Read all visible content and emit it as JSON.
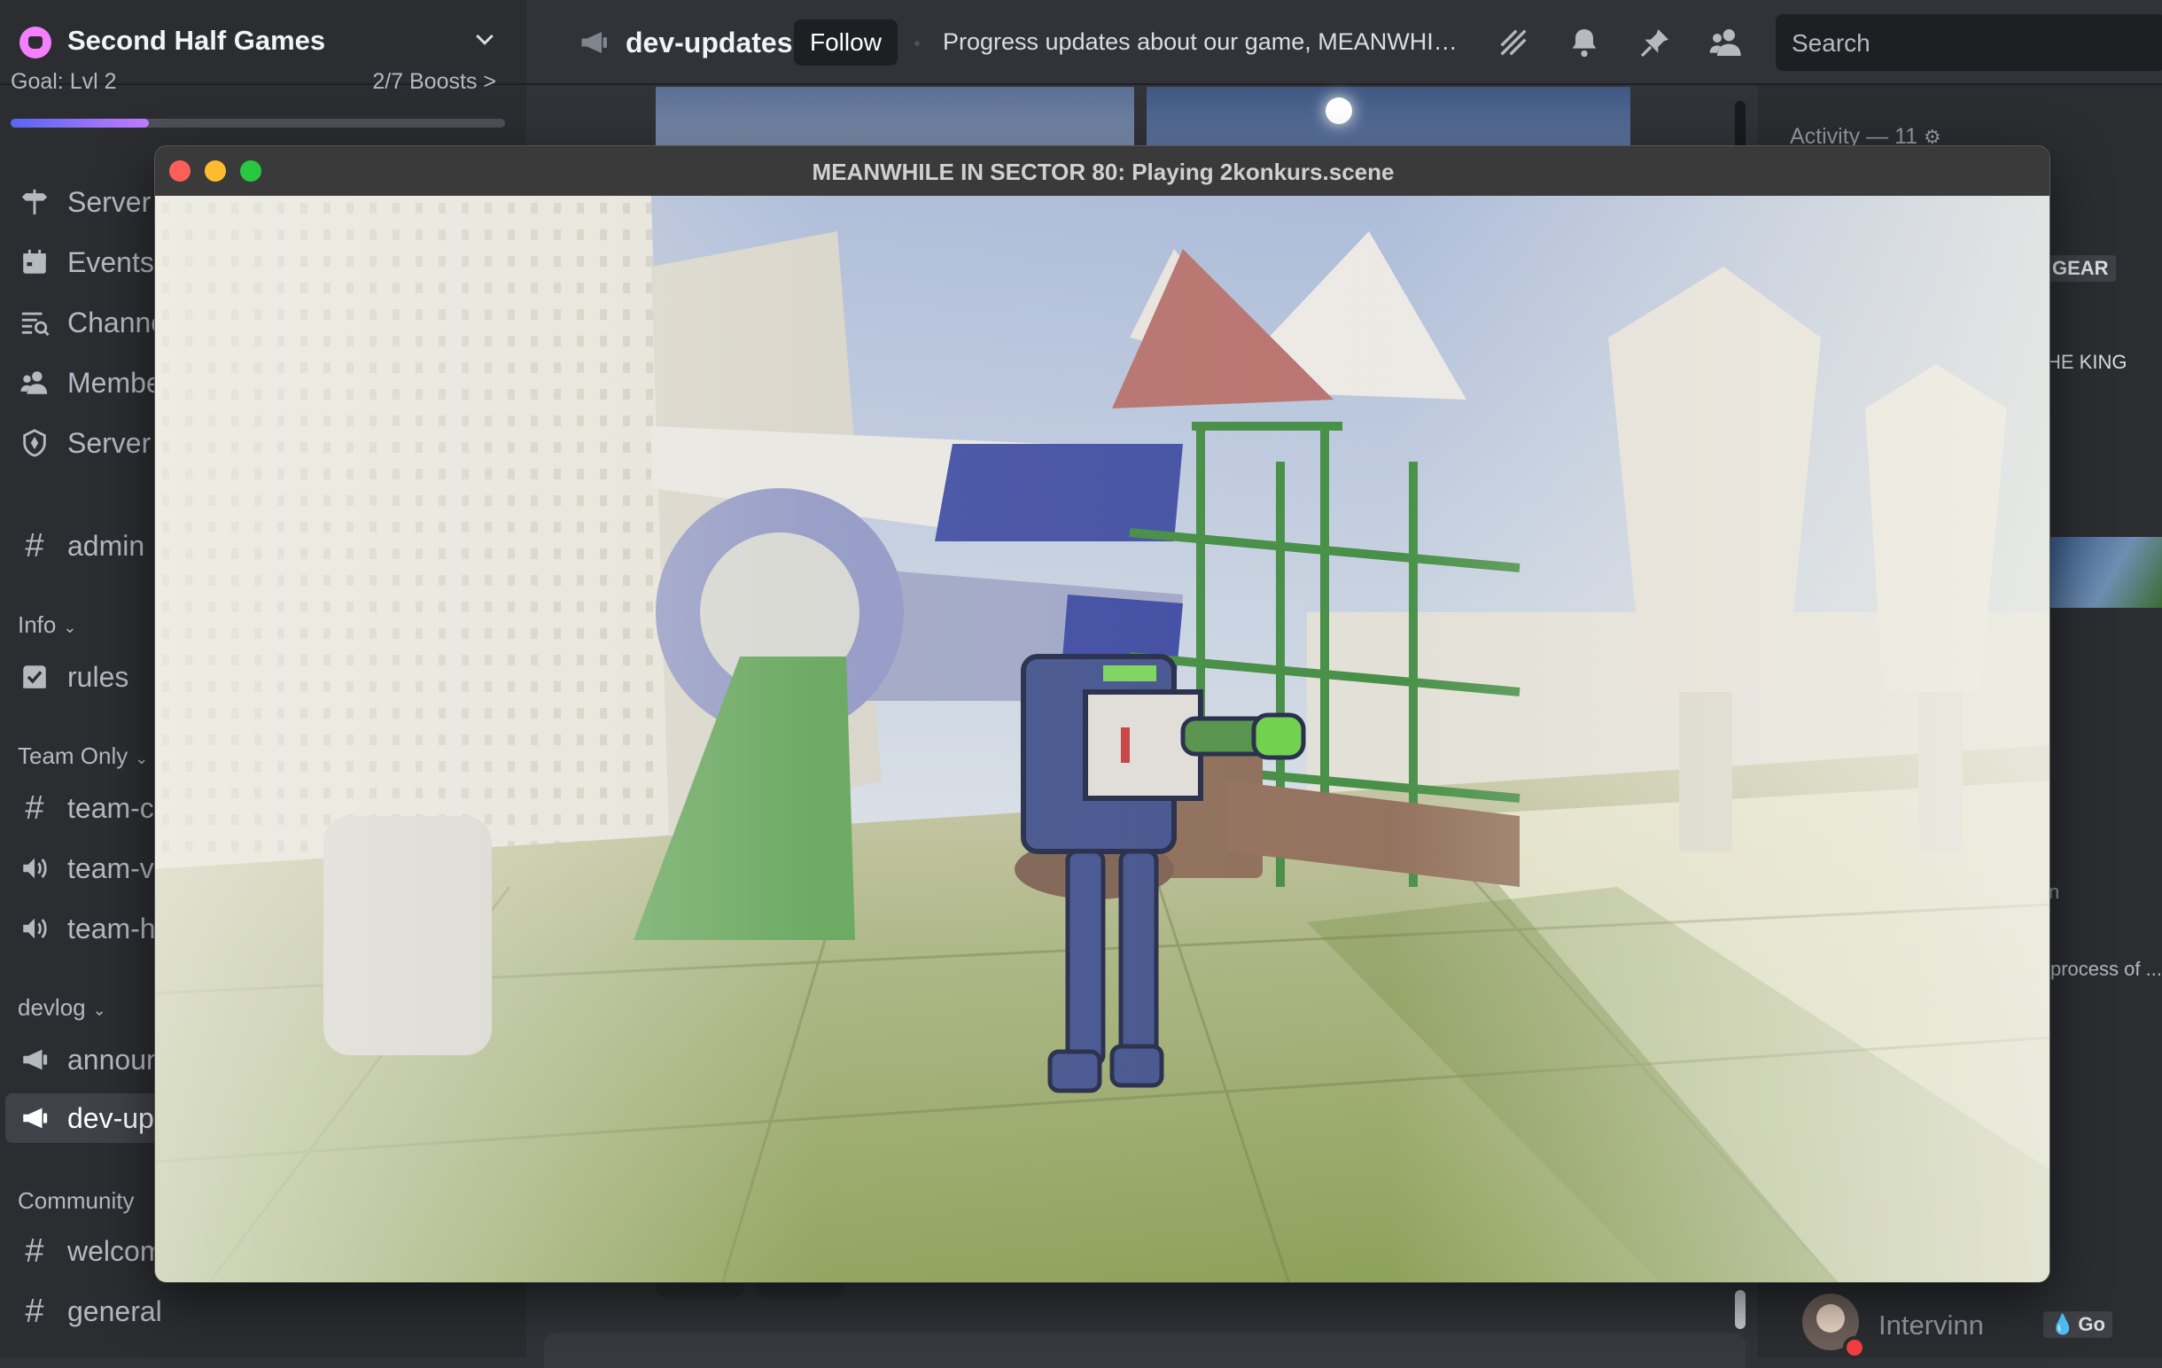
{
  "server": {
    "name": "Second Half Games",
    "boost_goal": "Goal: Lvl 2",
    "boost_count": "2/7 Boosts >",
    "boost_progress": 0.28
  },
  "sidebar": {
    "items": [
      {
        "label": "Server",
        "icon": "signpost-icon"
      },
      {
        "label": "Events",
        "icon": "calendar-icon"
      },
      {
        "label": "Channe",
        "icon": "channel-browse-icon"
      },
      {
        "label": "Membe",
        "icon": "members-icon"
      },
      {
        "label": "Server",
        "icon": "shield-icon"
      }
    ],
    "admin": "admin",
    "categories": {
      "info": "Info",
      "team_only": "Team Only",
      "devlog": "devlog",
      "community": "Community"
    },
    "rules": "rules",
    "team_channels": [
      "team-c",
      "team-v",
      "team-h"
    ],
    "devlog_channels": [
      "announ",
      "dev-up"
    ],
    "community_channels": [
      "welcom",
      "general"
    ]
  },
  "topbar": {
    "channel": "dev-updates",
    "follow_label": "Follow",
    "topic": "Progress updates about our game, MEANWHIL...",
    "search_placeholder": "Search"
  },
  "members": {
    "activity": "Activity — 11",
    "gear": "GEAR",
    "king": "HE KING",
    "n_fragment": "n",
    "process": "process of ...",
    "last_member": {
      "name": "Intervinn",
      "tag": "Go"
    }
  },
  "game_window": {
    "title": "MEANWHILE IN SECTOR 80: Playing 2konkurs.scene"
  },
  "colors": {
    "accent": "#5865f2",
    "sidebar_bg": "#2b2d31",
    "main_bg": "#313338",
    "close": "#ff5f57",
    "minimize": "#febc2e",
    "maximize": "#28c840"
  }
}
